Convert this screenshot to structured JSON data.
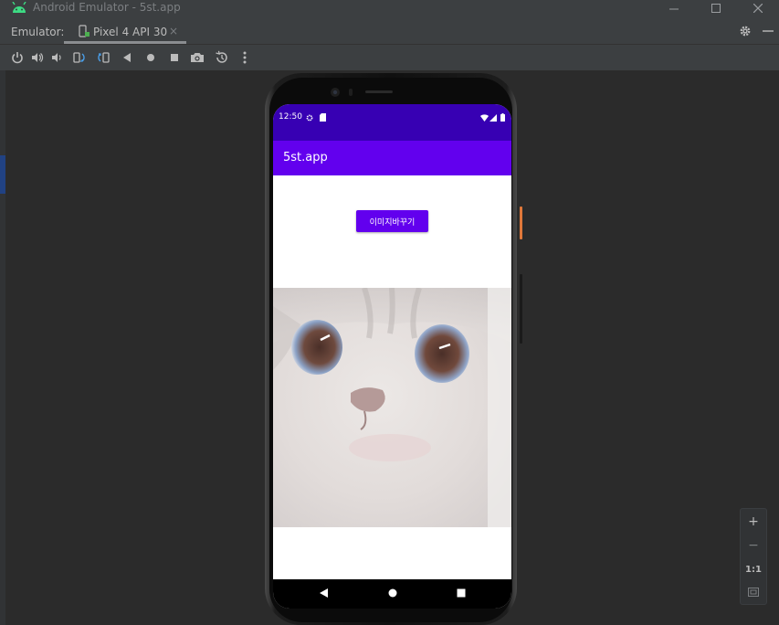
{
  "window": {
    "title": "Android Emulator - 5st.app"
  },
  "tabbar": {
    "label": "Emulator:",
    "tab_label": "Pixel 4 API 30",
    "tab_close": "×"
  },
  "toolbar": {
    "icons": [
      "power-icon",
      "volume-up-icon",
      "volume-down-icon",
      "rotate-left-icon",
      "rotate-right-icon",
      "back-icon",
      "home-icon",
      "overview-icon",
      "screenshot-icon",
      "snapshot-icon",
      "more-icon"
    ]
  },
  "phone": {
    "status_time": "12:50",
    "app_title": "5st.app",
    "button_label": "이미지바꾸기",
    "accent": "#6200ee",
    "status_color": "#3700b3"
  },
  "zoom": {
    "zoom_in": "+",
    "zoom_out": "−",
    "actual_size": "1:1"
  }
}
